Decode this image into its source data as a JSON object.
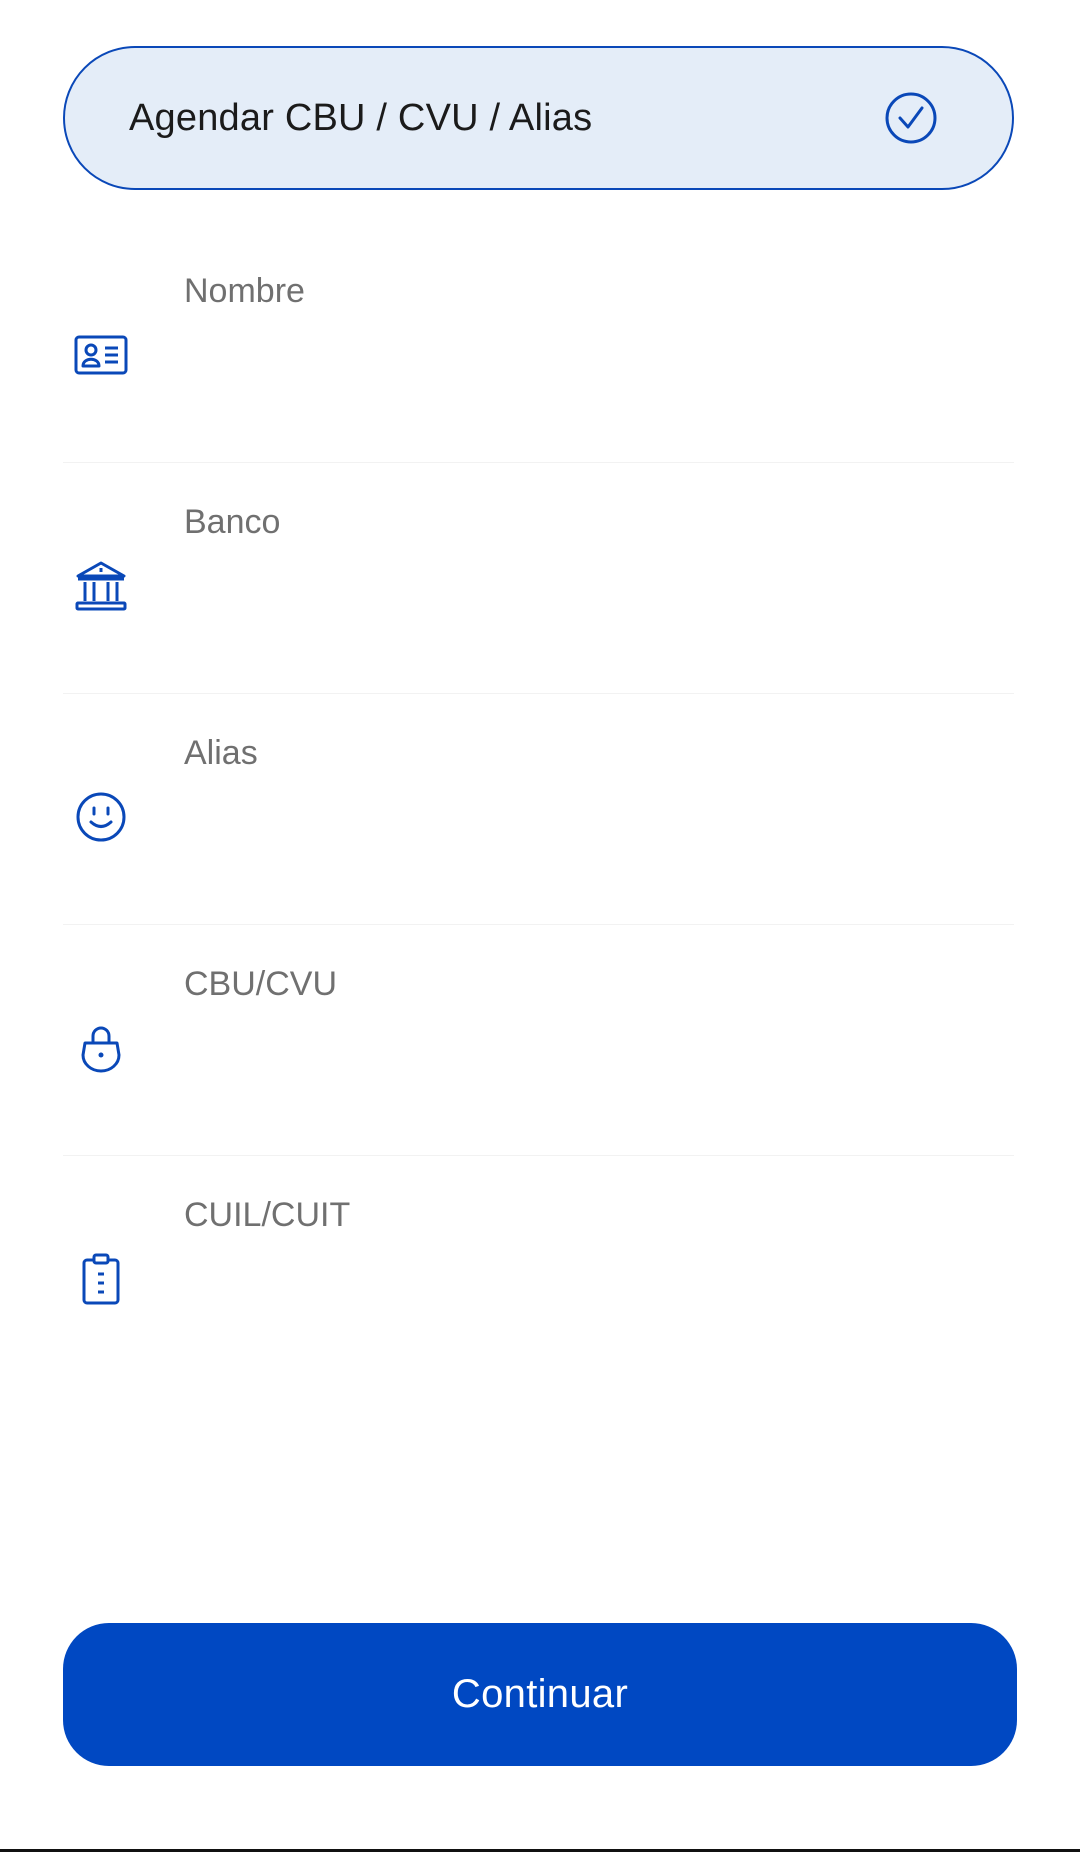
{
  "schedule_option": {
    "label": "Agendar CBU / CVU / Alias",
    "checked": true,
    "icon": "check-circle-icon"
  },
  "fields": [
    {
      "label": "Nombre",
      "value": "",
      "icon": "id-card-icon"
    },
    {
      "label": "Banco",
      "value": "",
      "icon": "bank-icon"
    },
    {
      "label": "Alias",
      "value": "",
      "icon": "smiley-icon"
    },
    {
      "label": "CBU/CVU",
      "value": "",
      "icon": "lock-icon"
    },
    {
      "label": "CUIL/CUIT",
      "value": "",
      "icon": "clipboard-icon"
    }
  ],
  "continue_button": {
    "label": "Continuar"
  },
  "colors": {
    "accent": "#0048c2",
    "pill_background": "#e4edf8",
    "label_gray": "#707070"
  }
}
